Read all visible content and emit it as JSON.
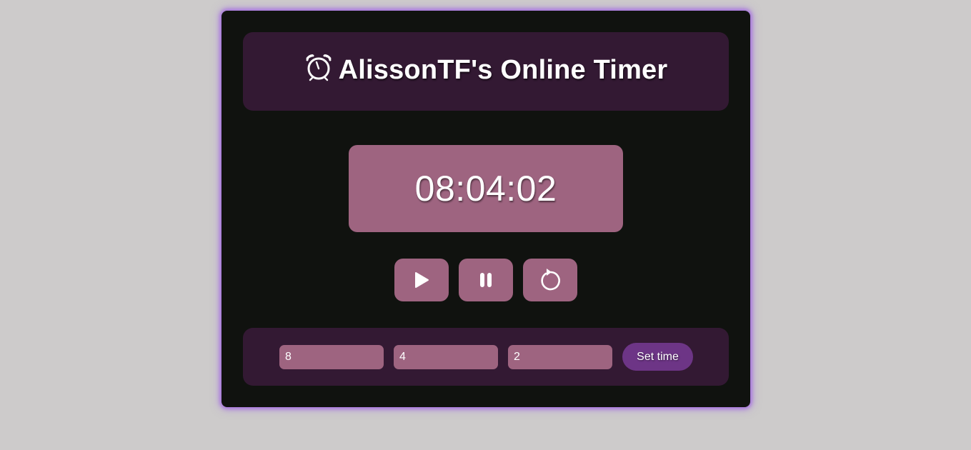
{
  "header": {
    "icon": "alarm-clock-icon",
    "title": "AlissonTF's Online Timer"
  },
  "timer": {
    "display": "08:04:02"
  },
  "controls": {
    "play_icon": "play-icon",
    "pause_icon": "pause-icon",
    "reset_icon": "reset-icon"
  },
  "setter": {
    "hours_value": "8",
    "minutes_value": "4",
    "seconds_value": "2",
    "set_label": "Set time"
  },
  "colors": {
    "page_bg": "#cdcbcb",
    "card_bg": "#10120f",
    "glow": "#a46de0",
    "panel_bg": "#331933",
    "accent_pink": "#9e6480",
    "button_purple": "#6d3586",
    "text": "#ffffff"
  }
}
